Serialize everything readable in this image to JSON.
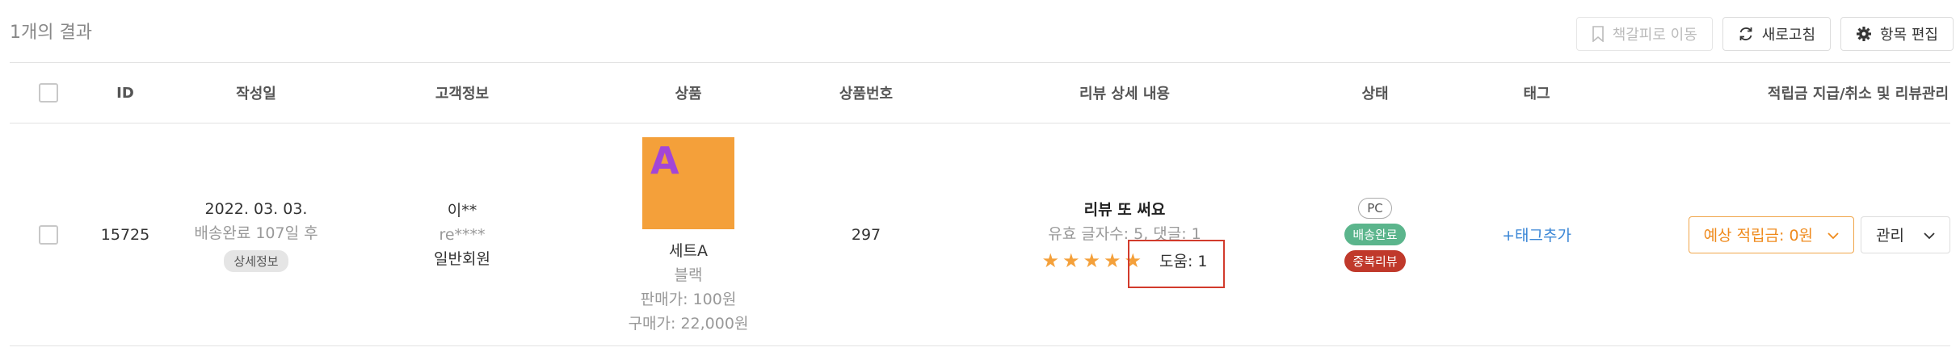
{
  "results": {
    "count_text": "1개의 결과"
  },
  "toolbar": {
    "bookmark_label": "책갈피로 이동",
    "refresh_label": "새로고침",
    "edit_columns_label": "항목 편집"
  },
  "table": {
    "headers": {
      "id": "ID",
      "date": "작성일",
      "customer": "고객정보",
      "product": "상품",
      "product_no": "상품번호",
      "review": "리뷰 상세 내용",
      "status": "상태",
      "tag": "태그",
      "reward": "적립금 지급/취소 및 리뷰관리"
    },
    "rows": [
      {
        "id": "15725",
        "date": "2022. 03. 03.",
        "delivery_note": "배송완료 107일 후",
        "detail_button": "상세정보",
        "customer_name": "이**",
        "customer_id": "re****",
        "customer_grade": "일반회원",
        "product_image_letter": "A",
        "product_name": "세트A",
        "product_option": "블랙",
        "sale_price": "판매가: 100원",
        "purchase_price": "구매가: 22,000원",
        "product_no": "297",
        "review_title": "리뷰 또 써요",
        "review_meta": "유효 글자수: 5, 댓글: 1",
        "rating": 5,
        "helpful": "도움: 1",
        "status_badges": {
          "platform": "PC",
          "delivery": "배송완료",
          "duplicate": "중복리뷰"
        },
        "tag_action": "+태그추가",
        "reward_button": "예상 적립금: 0원",
        "manage_button": "관리"
      }
    ]
  },
  "colors": {
    "accent_orange": "#ef8a1c",
    "badge_green": "#5bb58c",
    "badge_red": "#c0392b",
    "link_blue": "#3a86d6",
    "highlight_red": "#d23b2c"
  }
}
